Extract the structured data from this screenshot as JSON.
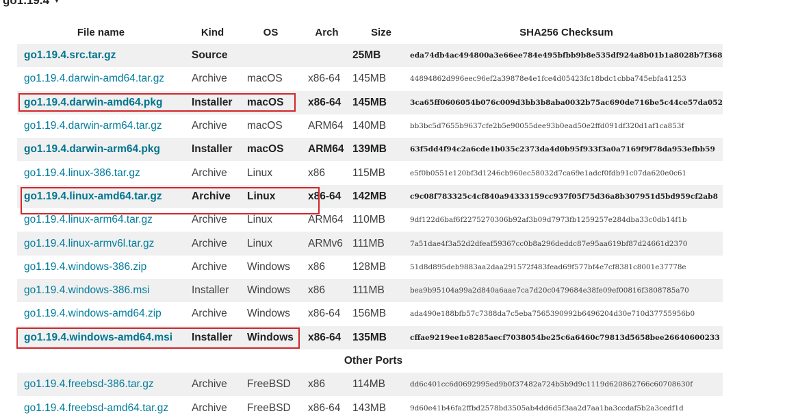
{
  "version": {
    "label": "go1.19.4",
    "caret": "▼"
  },
  "headers": [
    "File name",
    "Kind",
    "OS",
    "Arch",
    "Size",
    "SHA256 Checksum"
  ],
  "rows": [
    {
      "file": "go1.19.4.src.tar.gz",
      "kind": "Source",
      "os": "",
      "arch": "",
      "size": "25MB",
      "sha": "eda74db4ac494800a3e66ee784e495bfbb9b8e535df924a8b01b1a8028b7f368",
      "bold": true
    },
    {
      "file": "go1.19.4.darwin-amd64.tar.gz",
      "kind": "Archive",
      "os": "macOS",
      "arch": "x86-64",
      "size": "145MB",
      "sha": "44894862d996eec96ef2a39878e4e1fce4d05423fc18bdc1cbba745ebfa41253",
      "bold": false
    },
    {
      "file": "go1.19.4.darwin-amd64.pkg",
      "kind": "Installer",
      "os": "macOS",
      "arch": "x86-64",
      "size": "145MB",
      "sha": "3ca65ff0606054b076c009d3bb3b8aba0032b75ac690de716be5c44ce57da052",
      "bold": true
    },
    {
      "file": "go1.19.4.darwin-arm64.tar.gz",
      "kind": "Archive",
      "os": "macOS",
      "arch": "ARM64",
      "size": "140MB",
      "sha": "bb3bc5d7655b9637cfe2b5e90055dee93b0ead50e2ffd091df320d1af1ca853f",
      "bold": false
    },
    {
      "file": "go1.19.4.darwin-arm64.pkg",
      "kind": "Installer",
      "os": "macOS",
      "arch": "ARM64",
      "size": "139MB",
      "sha": "63f5dd4f94c2a6cde1b035c2373da4d0b95f933f3a0a7169f9f78da953efbb59",
      "bold": true
    },
    {
      "file": "go1.19.4.linux-386.tar.gz",
      "kind": "Archive",
      "os": "Linux",
      "arch": "x86",
      "size": "115MB",
      "sha": "e5f0b0551e120bf3d1246cb960ec58032d7ca69e1adcf0fdb91c07da620e0c61",
      "bold": false
    },
    {
      "file": "go1.19.4.linux-amd64.tar.gz",
      "kind": "Archive",
      "os": "Linux",
      "arch": "x86-64",
      "size": "142MB",
      "sha": "c9c08f783325c4cf840a94333159cc937f05f75d36a8b307951d5bd959cf2ab8",
      "bold": true
    },
    {
      "file": "go1.19.4.linux-arm64.tar.gz",
      "kind": "Archive",
      "os": "Linux",
      "arch": "ARM64",
      "size": "110MB",
      "sha": "9df122d6baf6f2275270306b92af3b09d7973fb1259257e284dba33c0db14f1b",
      "bold": false
    },
    {
      "file": "go1.19.4.linux-armv6l.tar.gz",
      "kind": "Archive",
      "os": "Linux",
      "arch": "ARMv6",
      "size": "111MB",
      "sha": "7a51dae4f3a52d2dfeaf59367cc0b8a296deddc87e95aa619bf87d24661d2370",
      "bold": false
    },
    {
      "file": "go1.19.4.windows-386.zip",
      "kind": "Archive",
      "os": "Windows",
      "arch": "x86",
      "size": "128MB",
      "sha": "51d8d895deb9883aa2daa291572f483fead69f577bf4e7cf8381c8001e37778e",
      "bold": false
    },
    {
      "file": "go1.19.4.windows-386.msi",
      "kind": "Installer",
      "os": "Windows",
      "arch": "x86",
      "size": "111MB",
      "sha": "bea9b95104a99a2d840a6aae7ca7d20c0479684e38fe09ef00816f3808785a70",
      "bold": false
    },
    {
      "file": "go1.19.4.windows-amd64.zip",
      "kind": "Archive",
      "os": "Windows",
      "arch": "x86-64",
      "size": "156MB",
      "sha": "ada490e188bfb57c7388da7c5eba7565390992b6496204d30e710d37755956b0",
      "bold": false
    },
    {
      "file": "go1.19.4.windows-amd64.msi",
      "kind": "Installer",
      "os": "Windows",
      "arch": "x86-64",
      "size": "135MB",
      "sha": "cffae9219ee1e8285aecf7038054be25c6a6460c79813d5658bee26640600233",
      "bold": true
    }
  ],
  "other_ports_label": "Other Ports",
  "other_rows": [
    {
      "file": "go1.19.4.freebsd-386.tar.gz",
      "kind": "Archive",
      "os": "FreeBSD",
      "arch": "x86",
      "size": "114MB",
      "sha": "dd6c401cc6d0692995ed9b0f37482a724b5b9d9c1119d620862766c60708630f",
      "bold": false
    },
    {
      "file": "go1.19.4.freebsd-amd64.tar.gz",
      "kind": "Archive",
      "os": "FreeBSD",
      "arch": "x86-64",
      "size": "143MB",
      "sha": "9d60e41b46fa2ffbd2578bd3505ab4dd6d5f3aa2d7aa1ba3ccdaf5b2a3cedf1d",
      "bold": false
    }
  ],
  "highlight_color": "#d0262b",
  "link_color": "#007d9c"
}
